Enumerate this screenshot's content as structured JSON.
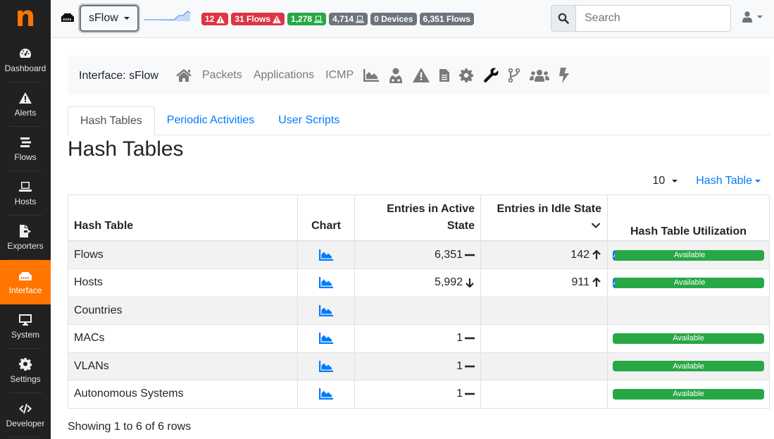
{
  "sidebar": {
    "logo": "n",
    "items": [
      {
        "label": "Dashboard",
        "icon": "tachometer-icon",
        "active": false
      },
      {
        "label": "Alerts",
        "icon": "warning-icon",
        "active": false
      },
      {
        "label": "Flows",
        "icon": "stream-icon",
        "active": false
      },
      {
        "label": "Hosts",
        "icon": "laptop-icon",
        "active": false
      },
      {
        "label": "Exporters",
        "icon": "file-export-icon",
        "active": false
      },
      {
        "label": "Interface",
        "icon": "ethernet-icon",
        "active": true
      },
      {
        "label": "System",
        "icon": "desktop-icon",
        "active": false
      },
      {
        "label": "Settings",
        "icon": "cog-icon",
        "active": false
      },
      {
        "label": "Developer",
        "icon": "code-icon",
        "active": false
      }
    ]
  },
  "topbar": {
    "interface_selected": "sFlow",
    "badges": [
      {
        "label": "12",
        "icon": "warning-icon",
        "color": "#dc3545"
      },
      {
        "label": "31 Flows",
        "icon": "warning-icon",
        "color": "#dc3545"
      },
      {
        "label": "1,278",
        "icon": "laptop-icon",
        "color": "#28a745"
      },
      {
        "label": "4,714",
        "icon": "laptop-icon",
        "color": "#6c757d"
      },
      {
        "label": "0 Devices",
        "icon": "",
        "color": "#6c757d"
      },
      {
        "label": "6,351 Flows",
        "icon": "",
        "color": "#6c757d"
      }
    ],
    "search_placeholder": "Search"
  },
  "interface_nav": {
    "title": "Interface: sFlow",
    "links": [
      "Packets",
      "Applications",
      "ICMP"
    ],
    "icons": [
      "area-chart-icon",
      "user-md-icon",
      "warning-icon",
      "file-icon",
      "cog-icon",
      "wrench-icon",
      "code-branch-icon",
      "users-icon",
      "bolt-icon"
    ]
  },
  "tabs": [
    {
      "label": "Hash Tables",
      "active": true
    },
    {
      "label": "Periodic Activities",
      "active": false
    },
    {
      "label": "User Scripts",
      "active": false
    }
  ],
  "page_title": "Hash Tables",
  "table_tools": {
    "page_size": "10",
    "columns_menu": "Hash Table"
  },
  "table": {
    "columns": [
      "Hash Table",
      "Chart",
      "Entries in Active State",
      "Entries in Idle State",
      "Hash Table Utilization"
    ],
    "sorted_column": "Entries in Idle State",
    "rows": [
      {
        "name": "Flows",
        "active": "6,351",
        "active_trend": "flat",
        "idle": "142",
        "idle_trend": "up",
        "utilization": {
          "used_label": "A",
          "free_label": "Available",
          "used_fraction": 0.015
        }
      },
      {
        "name": "Hosts",
        "active": "5,992",
        "active_trend": "down",
        "idle": "911",
        "idle_trend": "up",
        "utilization": {
          "used_label": "A",
          "free_label": "Available",
          "used_fraction": 0.015
        }
      },
      {
        "name": "Countries",
        "active": "",
        "active_trend": "",
        "idle": "",
        "idle_trend": "",
        "utilization": null
      },
      {
        "name": "MACs",
        "active": "1",
        "active_trend": "flat",
        "idle": "",
        "idle_trend": "",
        "utilization": {
          "used_label": "",
          "free_label": "Available",
          "used_fraction": 0
        }
      },
      {
        "name": "VLANs",
        "active": "1",
        "active_trend": "flat",
        "idle": "",
        "idle_trend": "",
        "utilization": {
          "used_label": "",
          "free_label": "Available",
          "used_fraction": 0
        }
      },
      {
        "name": "Autonomous Systems",
        "active": "1",
        "active_trend": "flat",
        "idle": "",
        "idle_trend": "",
        "utilization": {
          "used_label": "",
          "free_label": "Available",
          "used_fraction": 0
        }
      }
    ]
  },
  "footer": "Showing 1 to 6 of 6 rows"
}
